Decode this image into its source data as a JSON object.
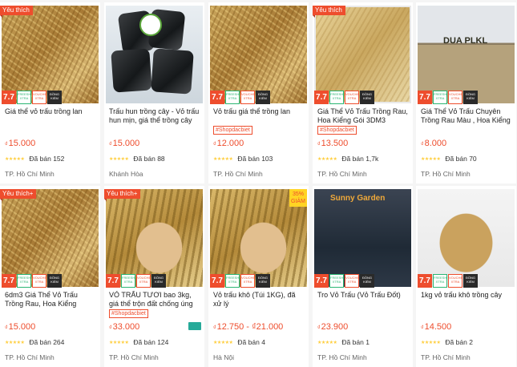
{
  "badges": {
    "sale_77": "7.7",
    "freeship": "FREESHIP XTRA",
    "voucher": "VOUCHER XTRA",
    "genuine": "ĐỒNG KIỂM",
    "like": "Yêu thích",
    "like_plus": "Yêu thích+",
    "shop_tag": "#Shopdacbiet",
    "discount": "35% GIẢM",
    "currency": "₫",
    "sold_prefix": "Đã bán"
  },
  "watermarks": {
    "dua_plkl": "DUA PLKL",
    "sunny_garden": "Sunny Garden"
  },
  "colors": {
    "accent": "#ee4d2d",
    "star": "#ffce3d",
    "teal": "#26aa99"
  },
  "products": [
    {
      "title": "Giá thể vỏ trấu trồng lan",
      "price": "15.000",
      "sold": "152",
      "location": "TP. Hồ Chí Minh",
      "like": "Yêu thích",
      "shop_tag": "",
      "stars": "★★★★★"
    },
    {
      "title": "Trấu hun trồng cây - Vỏ trấu hun mịn, giá thể trồng cây hoa",
      "price": "15.000",
      "sold": "88",
      "location": "Khánh Hòa",
      "like": "",
      "shop_tag": "",
      "stars": "★★★★★"
    },
    {
      "title": "Vỏ trấu giá thể trồng lan",
      "price": "12.000",
      "sold": "103",
      "location": "TP. Hồ Chí Minh",
      "like": "",
      "shop_tag": "#Shopdacbiet",
      "stars": "★★★★★"
    },
    {
      "title": "Giá Thể Vỏ Trấu Trồng Rau, Hoa Kiểng Gói 3DM3",
      "price": "13.500",
      "sold": "1,7k",
      "location": "TP. Hồ Chí Minh",
      "like": "Yêu thích",
      "shop_tag": "#Shopdacbiet",
      "stars": "★★★★★"
    },
    {
      "title": "Giá Thể Vỏ Trấu Chuyên Trồng Rau Màu , Hoa Kiểng Gói...",
      "price": "8.000",
      "sold": "70",
      "location": "TP. Hồ Chí Minh",
      "like": "",
      "shop_tag": "",
      "stars": "★★★★★"
    },
    {
      "title": "6dm3 Giá Thể Vỏ Trấu Trồng Rau, Hoa Kiểng",
      "price": "15.000",
      "sold": "264",
      "location": "TP. Hồ Chí Minh",
      "like": "Yêu thích+",
      "shop_tag": "",
      "stars": "★★★★★"
    },
    {
      "title": "VỎ TRẤU TƯƠI bao 3kg, giá thể trộn đất chống úng bao 3kg",
      "price": "33.000",
      "sold": "124",
      "location": "TP. Hồ Chí Minh",
      "like": "Yêu thích+",
      "shop_tag": "#Shopdacbiet",
      "stars": "★★★★★"
    },
    {
      "title": "Vỏ trấu khô (Túi 1KG), đã xử lý",
      "price": "12.750 - ₫21.000",
      "sold": "4",
      "location": "Hà Nội",
      "like": "",
      "shop_tag": "",
      "stars": "★★★★★"
    },
    {
      "title": "Tro Vỏ Trấu (Vỏ Trấu Đốt)",
      "price": "23.900",
      "sold": "1",
      "location": "TP. Hồ Chí Minh",
      "like": "",
      "shop_tag": "",
      "stars": "★★★★★"
    },
    {
      "title": "1kg vỏ trấu khô trồng cây",
      "price": "14.500",
      "sold": "2",
      "location": "TP. Hồ Chí Minh",
      "like": "",
      "shop_tag": "",
      "stars": "★★★★★"
    }
  ]
}
